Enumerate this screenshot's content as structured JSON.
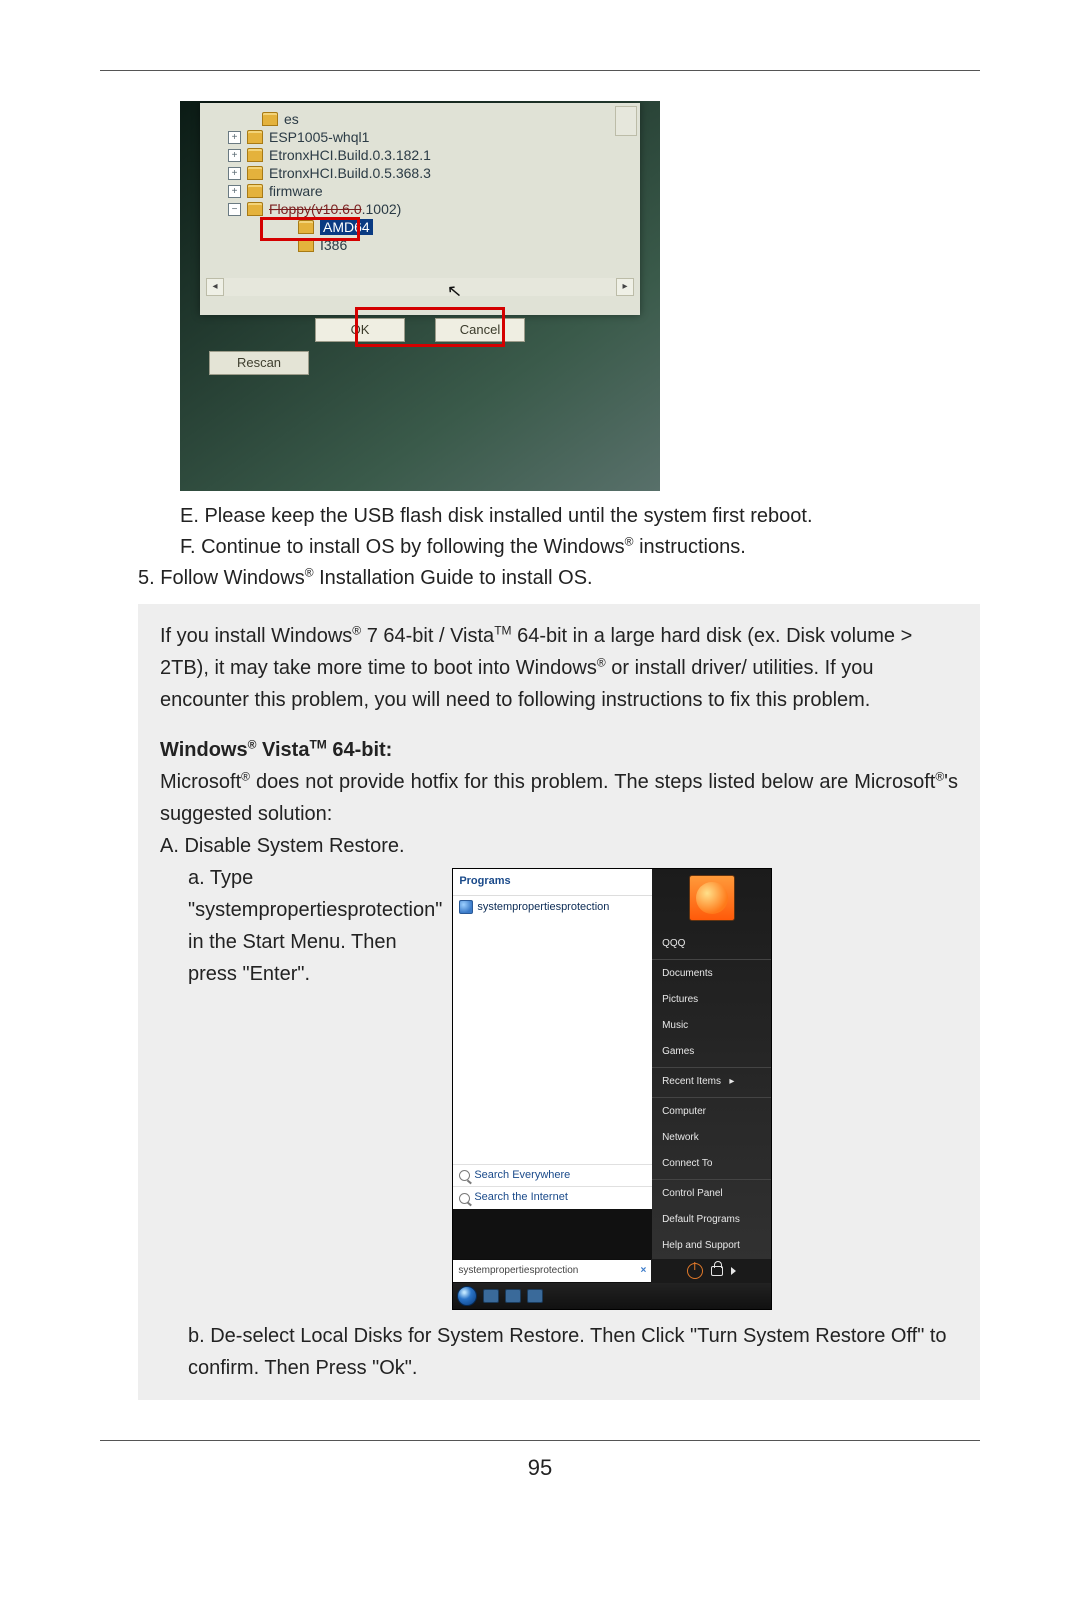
{
  "page_number": "95",
  "photo1": {
    "tree": {
      "r1": "es",
      "r2": "ESP1005-whql1",
      "r3": "EtronxHCI.Build.0.3.182.1",
      "r4": "EtronxHCI.Build.0.5.368.3",
      "r5": "firmware",
      "r6_pre": "Floppy(v10.6.0",
      "r6_post": ".1002)",
      "r7": "AMD64",
      "r8": "I386"
    },
    "ok": "OK",
    "cancel": "Cancel",
    "rescan": "Rescan"
  },
  "text": {
    "e": "E. Please keep the USB flash disk installed until the system first reboot.",
    "f_pre": "F. Continue to install OS by following the Windows",
    "f_post": " instructions.",
    "step5_pre": "5. Follow Windows",
    "step5_post": " Installation Guide to install OS."
  },
  "note": {
    "p1a": "If you install Windows",
    "p1b": " 7 64-bit / Vista",
    "p1c": " 64-bit in a large hard disk (ex. Disk volume > 2TB), it may take more time to boot into Windows",
    "p1d": " or install driver/ utilities. If you encounter this problem, you will need to following instructions to fix this problem.",
    "h1a": "Windows",
    "h1b": " Vista",
    "h1c": " 64-bit:",
    "p2a": "Microsoft",
    "p2b": " does not provide hotfix for this problem. The steps listed below are Microsoft",
    "p2c": "'s suggested solution:",
    "A": "A. Disable System Restore.",
    "Aa": "a. Type \"systempropertiesprotection\" in the Start Menu. Then press \"Enter\".",
    "Ab": "b. De-select Local Disks for System Restore. Then Click \"Turn System Restore Off\" to confirm. Then Press \"Ok\"."
  },
  "vista": {
    "programs": "Programs",
    "result": "systempropertiesprotection",
    "search_everywhere": "Search Everywhere",
    "search_internet": "Search the Internet",
    "searchbox": "systempropertiesprotection",
    "right": {
      "user": "QQQ",
      "documents": "Documents",
      "pictures": "Pictures",
      "music": "Music",
      "games": "Games",
      "recent": "Recent Items",
      "computer": "Computer",
      "network": "Network",
      "connect": "Connect To",
      "controlpanel": "Control Panel",
      "defaultprog": "Default Programs",
      "help": "Help and Support"
    }
  }
}
